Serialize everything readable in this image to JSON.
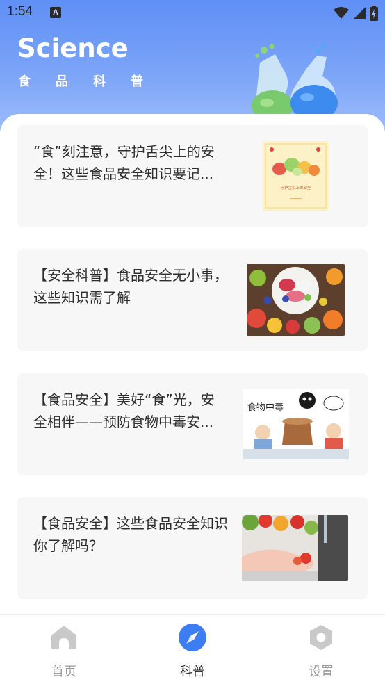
{
  "status_bar": {
    "time": "1:54",
    "notification_letter": "A"
  },
  "header": {
    "title": "Science",
    "subtitle": "食品科普"
  },
  "articles": [
    {
      "title": "“食”刻注意，守护舌尖上的安全！这些食品安全知识要记...",
      "thumb": "poster-thumbnail",
      "poster_text": "守护舌尖上的安全"
    },
    {
      "title": "【安全科普】食品安全无小事，这些知识需了解",
      "thumb": "fruit-bowl-thumbnail"
    },
    {
      "title": "【食品安全】美好“食”光，安全相伴——预防食物中毒安...",
      "thumb": "cartoon-thumbnail",
      "cartoon_text": "食物中毒"
    },
    {
      "title": "【食品安全】这些食品安全知识你了解吗？",
      "thumb": "washing-vegetables-thumbnail"
    }
  ],
  "tabs": [
    {
      "label": "首页",
      "icon": "home-icon",
      "active": false
    },
    {
      "label": "科普",
      "icon": "compass-icon",
      "active": true
    },
    {
      "label": "设置",
      "icon": "settings-icon",
      "active": false
    }
  ],
  "colors": {
    "header_top": "#5f8ff6",
    "header_bottom": "#a6c2fb",
    "active_tab": "#3d7df3",
    "inactive_icon": "#c9c9c9"
  }
}
